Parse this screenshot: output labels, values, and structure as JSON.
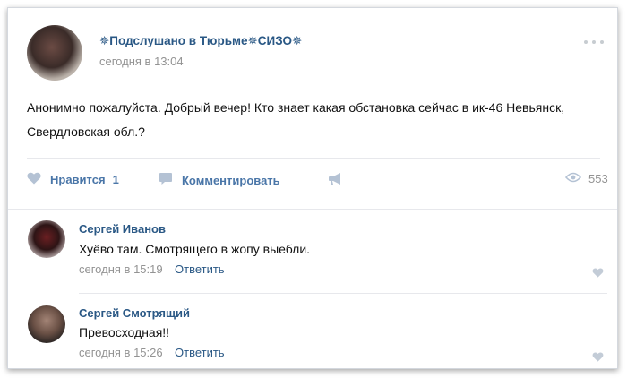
{
  "post": {
    "author": "✵Подслушано в Тюрьме✵СИЗО✵",
    "time": "сегодня в 13:04",
    "text": "Анонимно пожалуйста. Добрый вечер! Кто знает какая обстановка сейчас в ик-46 Невьянск, Свердловская обл.?"
  },
  "actions": {
    "like_label": "Нравится",
    "like_count": "1",
    "comment_label": "Комментировать",
    "views": "553"
  },
  "comments": [
    {
      "author": "Сергей Иванов",
      "text": "Хуёво там. Смотрящего в жопу выебли.",
      "time": "сегодня в 15:19",
      "reply": "Ответить"
    },
    {
      "author": "Сергей Смотрящий",
      "text": "Превосходная!!",
      "time": "сегодня в 15:26",
      "reply": "Ответить"
    }
  ],
  "colors": {
    "link": "#2a5885",
    "action": "#4a76a8",
    "meta": "#939393",
    "icon": "#b4c2d4"
  },
  "icons": [
    "heart-icon",
    "comment-icon",
    "share-icon",
    "eye-icon",
    "more-icon"
  ]
}
